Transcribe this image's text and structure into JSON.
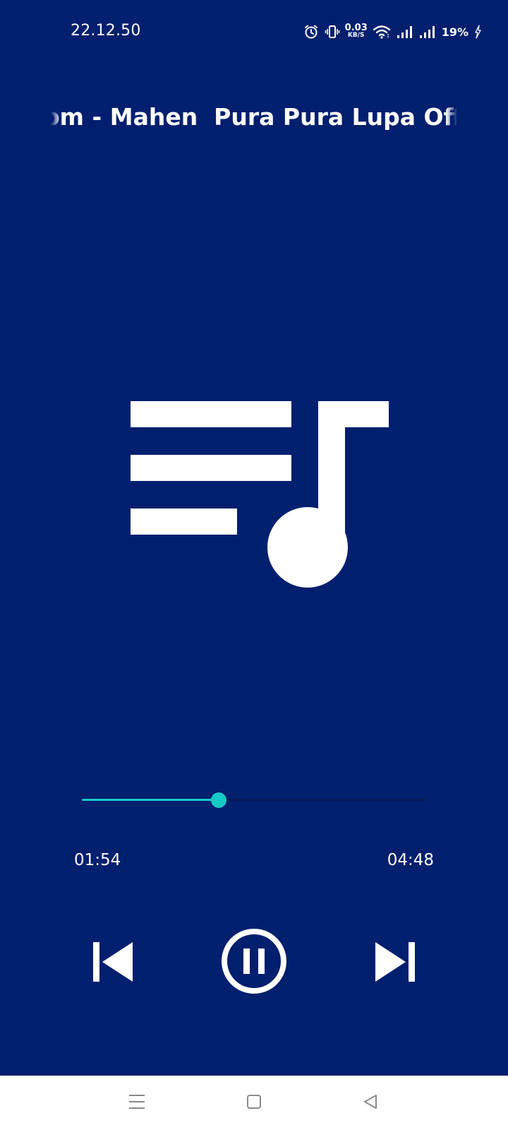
{
  "status_bar": {
    "time": "22.12.50",
    "net_speed_value": "0.03",
    "net_speed_unit": "KB/S",
    "battery_percent": "19%",
    "icons": [
      "alarm-icon",
      "vibrate-icon",
      "wifi-icon",
      "signal-icon",
      "signal-icon",
      "charging-icon"
    ]
  },
  "player": {
    "title": "om - Mahen  Pura Pura Lupa Offic",
    "art_icon": "playlist-music-icon",
    "progress": {
      "current": "01:54",
      "total": "04:48",
      "fraction": 0.397
    },
    "controls": {
      "previous_icon": "skip-previous-icon",
      "pause_icon": "pause-circle-icon",
      "next_icon": "skip-next-icon"
    }
  },
  "nav_bar": {
    "icons": [
      "menu-icon",
      "home-icon",
      "back-icon"
    ]
  },
  "colors": {
    "background": "#001f6e",
    "accent": "#17c8c6",
    "nav_background": "#ffffff"
  }
}
